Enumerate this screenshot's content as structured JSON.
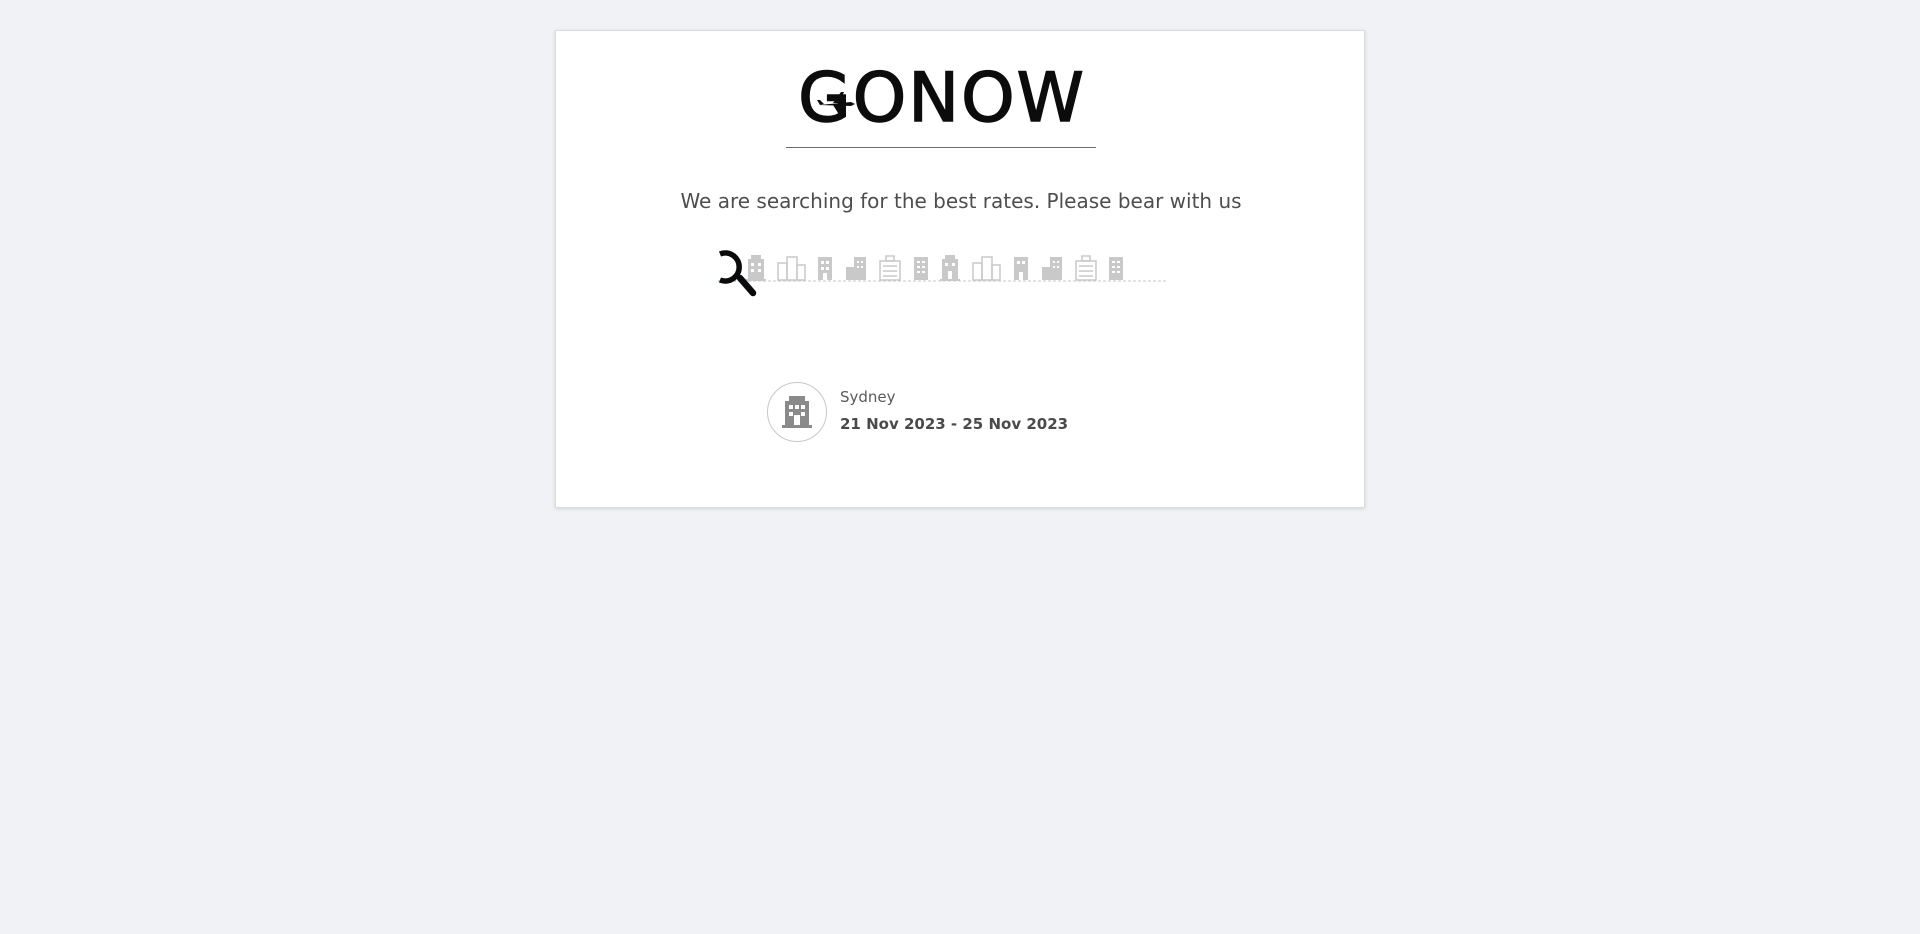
{
  "brand": {
    "name": "GONOW"
  },
  "loading": {
    "message": "We are searching for the best rates. Please bear with us"
  },
  "search": {
    "destination": "Sydney",
    "date_range": "21 Nov 2023 - 25 Nov 2023"
  },
  "icons": {
    "logo_plane": "airplane-icon",
    "search": "magnifier-icon",
    "buildings": "building-icon",
    "hotel": "hotel-icon"
  },
  "colors": {
    "background": "#f1f2f6",
    "card": "#ffffff",
    "text": "#4e4e4e",
    "skyline": "#bdbdbd",
    "logo": "#0c0c0c"
  }
}
